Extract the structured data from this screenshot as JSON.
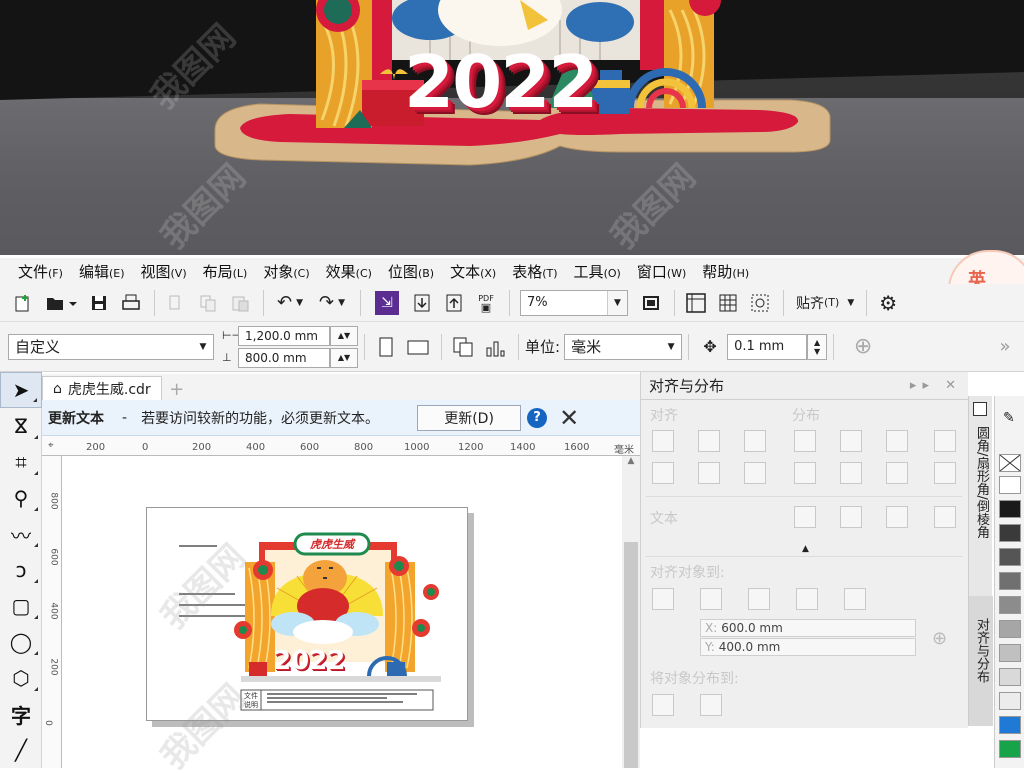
{
  "menu": [
    {
      "label": "文件",
      "key": "(F)"
    },
    {
      "label": "编辑",
      "key": "(E)"
    },
    {
      "label": "视图",
      "key": "(V)"
    },
    {
      "label": "布局",
      "key": "(L)"
    },
    {
      "label": "对象",
      "key": "(C)"
    },
    {
      "label": "效果",
      "key": "(C)"
    },
    {
      "label": "位图",
      "key": "(B)"
    },
    {
      "label": "文本",
      "key": "(X)"
    },
    {
      "label": "表格",
      "key": "(T)"
    },
    {
      "label": "工具",
      "key": "(O)"
    },
    {
      "label": "窗口",
      "key": "(W)"
    },
    {
      "label": "帮助",
      "key": "(H)"
    }
  ],
  "corner_badge": "英",
  "toolbar1": {
    "zoom": "7%",
    "snap_label": "贴齐",
    "snap_key": "(T)",
    "pdf_label": "PDF"
  },
  "toolbar2": {
    "page_size": "自定义",
    "width": "1,200.0 mm",
    "height": "800.0 mm",
    "unit_label": "单位:",
    "unit": "毫米",
    "nudge": "0.1 mm"
  },
  "document": {
    "tab_name": "虎虎生威.cdr",
    "notice_title": "更新文本",
    "notice_sep": "-",
    "notice_text": "若要访问较新的功能，必须更新文本。",
    "update_button": "更新(D)",
    "help": "?",
    "ruler_unit": "毫米",
    "ruler_ticks": [
      "200",
      "0",
      "200",
      "400",
      "600",
      "800",
      "1000",
      "1200",
      "1400",
      "1600"
    ],
    "ruler_v_ticks": [
      "800",
      "600",
      "400",
      "200",
      "0"
    ]
  },
  "artwork": {
    "banner": "虎虎生威",
    "year": "2022",
    "caption_label_1": "文件",
    "caption_label_2": "说明"
  },
  "docker": {
    "title": "对齐与分布",
    "sec_align": "对齐",
    "sec_distribute": "分布",
    "sec_text": "文本",
    "sec_align_to": "对齐对象到:",
    "x_label": "X:",
    "x_value": "600.0 mm",
    "y_label": "Y:",
    "y_value": "400.0 mm",
    "sec_distribute_to": "将对象分布到:"
  },
  "docker_tabs": [
    "圆角/扇形角/倒棱角",
    "对齐与分布"
  ],
  "palette": [
    "#ffffff",
    "#1a1a1a",
    "#3a3a3a",
    "#555555",
    "#707070",
    "#8c8c8c",
    "#a6a6a6",
    "#c0c0c0",
    "#d9d9d9",
    "#ececec",
    "#1f7ad6",
    "#16a34a"
  ]
}
